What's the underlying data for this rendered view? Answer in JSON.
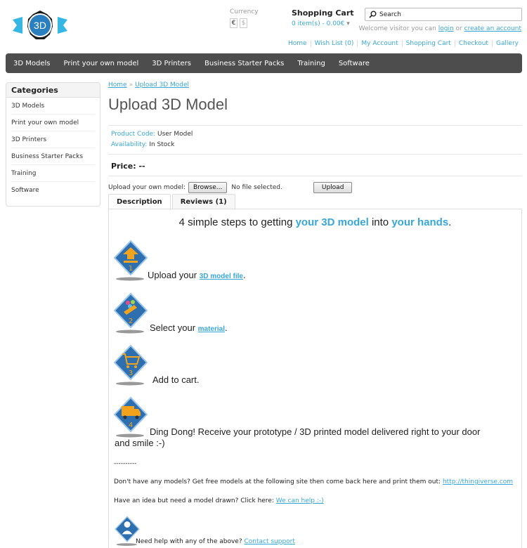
{
  "logo": {
    "text": "3D"
  },
  "currency": {
    "label": "Currency",
    "options": [
      "€",
      "$"
    ]
  },
  "cart": {
    "title": "Shopping Cart",
    "summary": "0 item(s) - 0.00€"
  },
  "search": {
    "placeholder": "Search"
  },
  "welcome": {
    "prefix": "Welcome visitor you can",
    "login": "login",
    "or": "or",
    "create": "create an account"
  },
  "top_links": [
    "Home",
    "Wish List (0)",
    "My Account",
    "Shopping Cart",
    "Checkout",
    "Gallery"
  ],
  "nav": [
    "3D Models",
    "Print your own model",
    "3D Printers",
    "Business Starter Packs",
    "Training",
    "Software"
  ],
  "sidebar": {
    "title": "Categories",
    "items": [
      "3D Models",
      "Print your own model",
      "3D Printers",
      "Business Starter Packs",
      "Training",
      "Software"
    ]
  },
  "breadcrumb": {
    "home": "Home",
    "sep": "»",
    "current": "Upload 3D Model"
  },
  "page_title": "Upload 3D Model",
  "product": {
    "code_label": "Product Code:",
    "code_value": "User Model",
    "avail_label": "Availability:",
    "avail_value": "In Stock",
    "price": "Price: --"
  },
  "upload": {
    "label": "Upload your own model:",
    "browse": "Browse...",
    "no_file": "No file selected.",
    "button": "Upload"
  },
  "tabs": [
    "Description",
    "Reviews (1)"
  ],
  "headline": {
    "a": "4 simple steps to getting ",
    "b": "your 3D model",
    "c": " into ",
    "d": "your hands",
    "e": "."
  },
  "steps": [
    {
      "num": "1",
      "pre": "Upload your ",
      "link": "3D model file",
      "post": "."
    },
    {
      "num": "2",
      "pre": "Select your ",
      "link": "material",
      "post": "."
    },
    {
      "num": "3",
      "pre": "Add to cart.",
      "link": "",
      "post": ""
    },
    {
      "num": "4",
      "pre": "Ding Dong! Receive your prototype / 3D printed model delivered right to your door",
      "line2": "and smile :-)"
    }
  ],
  "divider_text": "----------",
  "free_models": {
    "text": "Don't have any models?  Get free models at the following site then come back here and print them out: ",
    "link": "http://thingiverse.com"
  },
  "idea": {
    "text": "Have an idea but need a model drawn? Click here: ",
    "link": "We can help :-)"
  },
  "help": {
    "text": "Need help with any of the above? ",
    "link": "Contact support"
  },
  "colors": {
    "accent": "#38a7d8",
    "nav_bg": "#4d4d4d",
    "icon_blue": "#2e6fb0",
    "icon_orange": "#f3a31b"
  }
}
